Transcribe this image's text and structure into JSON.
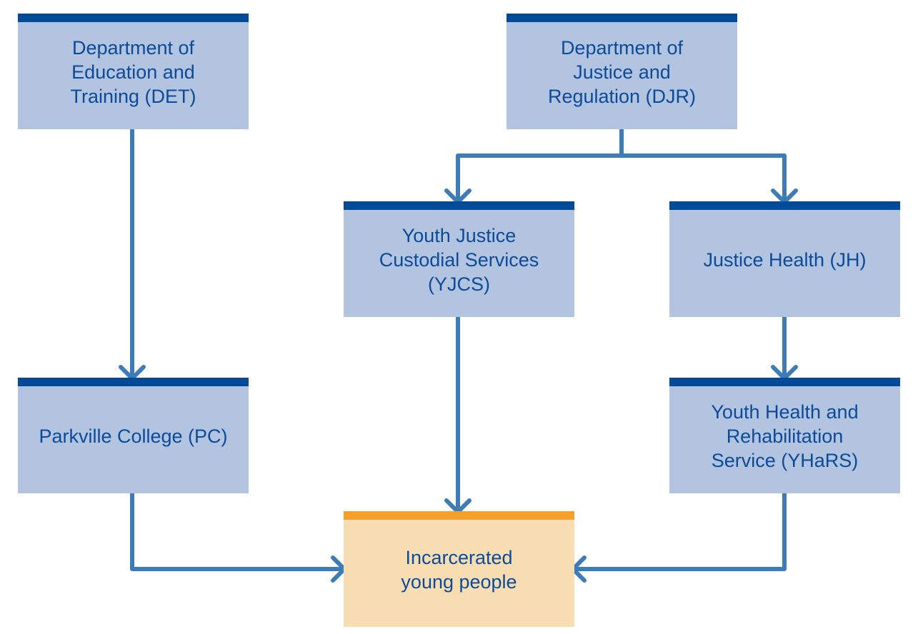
{
  "diagram": {
    "type": "organizational-flow",
    "colors": {
      "node_fill": "#b3c4e1",
      "node_header": "#004a97",
      "target_fill": "#f8ddb2",
      "target_header": "#f6a02c",
      "text": "#0b4b9a",
      "arrow": "#3e7cb8"
    },
    "nodes": {
      "det": {
        "label": "Department of\nEducation and\nTraining (DET)"
      },
      "djr": {
        "label": "Department of\nJustice and\nRegulation (DJR)"
      },
      "yjcs": {
        "label": "Youth Justice\nCustodial Services\n(YJCS)"
      },
      "jh": {
        "label": "Justice Health (JH)"
      },
      "pc": {
        "label": "Parkville College (PC)"
      },
      "yhars": {
        "label": "Youth Health and\nRehabilitation\nService (YHaRS)"
      },
      "iyp": {
        "label": "Incarcerated\nyoung people"
      }
    },
    "edges": [
      {
        "from": "det",
        "to": "pc"
      },
      {
        "from": "djr",
        "to": "yjcs"
      },
      {
        "from": "djr",
        "to": "jh"
      },
      {
        "from": "jh",
        "to": "yhars"
      },
      {
        "from": "yjcs",
        "to": "iyp"
      },
      {
        "from": "pc",
        "to": "iyp"
      },
      {
        "from": "yhars",
        "to": "iyp"
      }
    ]
  }
}
